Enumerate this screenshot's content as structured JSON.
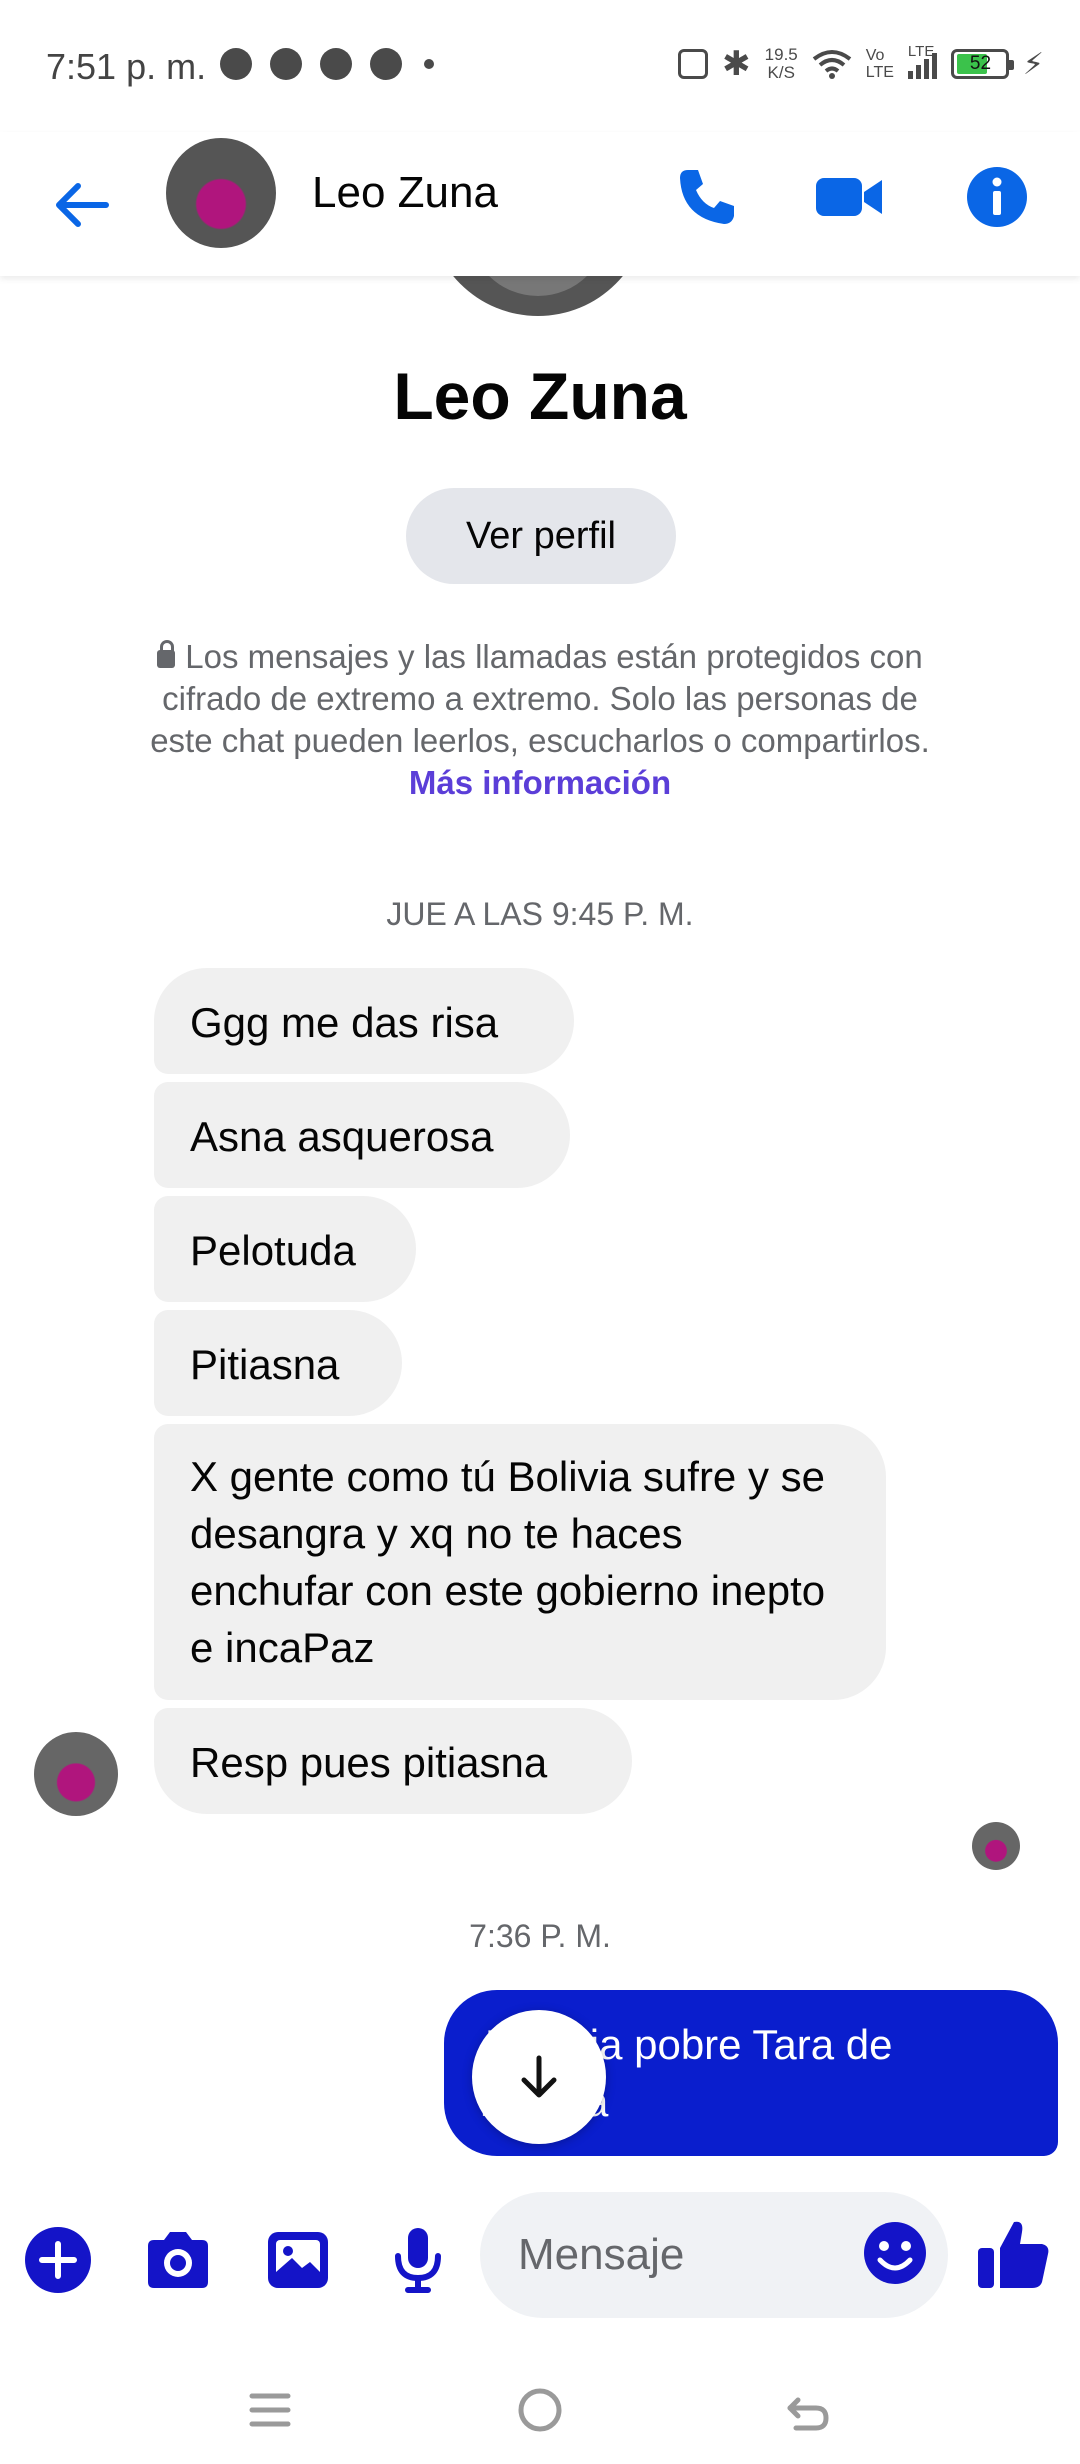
{
  "status_bar": {
    "time": "7:51 p. m.",
    "net_speed_value": "19.5",
    "net_speed_unit": "K/S",
    "volte_top": "Vo",
    "volte_bottom": "LTE",
    "signal_label": "LTE",
    "battery_level": "52",
    "icons": [
      "whatsapp-icon",
      "tinder-icon",
      "messenger-icon",
      "facebook-icon",
      "dot-icon",
      "nfc-icon",
      "bluetooth-icon",
      "wifi-icon",
      "signal-icon",
      "battery-icon",
      "charging-icon"
    ]
  },
  "header": {
    "contact_name": "Leo Zuna",
    "accent_color": "#0a66e6"
  },
  "profile": {
    "name": "Leo Zuna",
    "view_profile_label": "Ver perfil"
  },
  "encryption_notice": {
    "text": "Los mensajes y las llamadas están protegidos con cifrado de extremo a extremo. Solo las personas de este chat pueden leerlos, escucharlos o compartirlos.",
    "link_text": "Más información"
  },
  "messages": {
    "timestamp_1": "JUE A LAS 9:45 P. M.",
    "incoming": [
      "Ggg me das risa",
      "Asna asquerosa",
      "Pelotuda",
      "Pitiasna",
      "X gente como tú Bolivia sufre y se desangra y xq no te haces enchufar con este gobierno inepto e incaPaz",
      "Resp pues pitiasna"
    ],
    "timestamp_2": "7:36 P. M.",
    "outgoing": [
      "Jajajaja pobre Tara de mierda"
    ],
    "outgoing_bubble_color": "#0a1ecd"
  },
  "composer": {
    "placeholder": "Mensaje",
    "accent_color": "#1414c8"
  }
}
